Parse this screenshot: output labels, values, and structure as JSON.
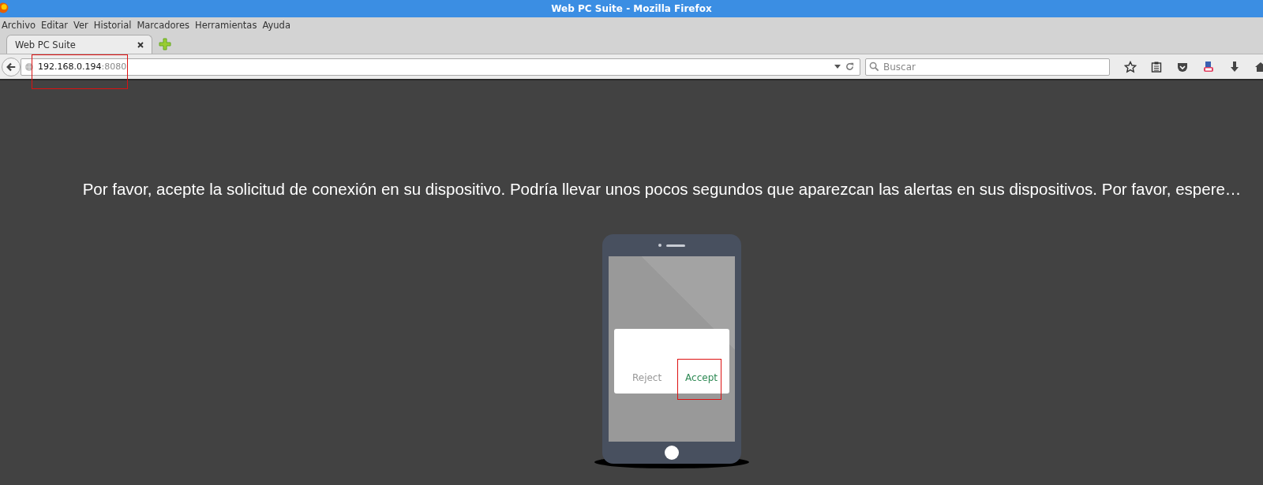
{
  "window": {
    "title": "Web PC Suite - Mozilla Firefox"
  },
  "menu": [
    "Archivo",
    "Editar",
    "Ver",
    "Historial",
    "Marcadores",
    "Herramientas",
    "Ayuda"
  ],
  "tabs": [
    {
      "label": "Web PC Suite",
      "selected": true
    }
  ],
  "address_bar": {
    "host": "192.168.0.194",
    "port": ":8080",
    "highlighted": true
  },
  "search": {
    "placeholder": "Buscar"
  },
  "page": {
    "message": "Por favor, acepte la solicitud de conexión en su dispositivo. Podría llevar unos pocos segundos que aparezcan las alertas en sus dispositivos. Por favor, espere…",
    "dialog_buttons": [
      {
        "label": "Reject",
        "kind": "reject",
        "highlighted": false
      },
      {
        "label": "Accept",
        "kind": "accept",
        "highlighted": true
      }
    ]
  }
}
